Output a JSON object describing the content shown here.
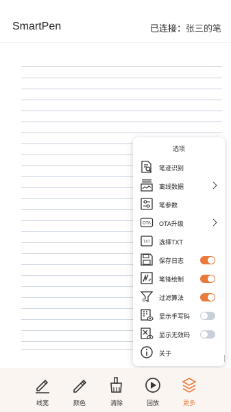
{
  "header": {
    "app_title": "SmartPen",
    "status_prefix": "已连接：",
    "pen_name": "张三的笔"
  },
  "menu": {
    "title": "选项",
    "items": [
      {
        "label": "笔迹识别"
      },
      {
        "label": "离线数据"
      },
      {
        "label": "笔参数"
      },
      {
        "label": "OTA升级"
      },
      {
        "label": "选择TXT"
      },
      {
        "label": "保存日志",
        "toggle": "on"
      },
      {
        "label": "笔锋绘制",
        "toggle": "on"
      },
      {
        "label": "过滤算法",
        "toggle": "on"
      },
      {
        "label": "显示手写码",
        "toggle": "off"
      },
      {
        "label": "显示无效码",
        "toggle": "off"
      },
      {
        "label": "关于"
      }
    ]
  },
  "icons": {
    "ota_text": "OTA",
    "txt_text": "TXT"
  },
  "tabbar": {
    "tabs": [
      {
        "label": "线宽"
      },
      {
        "label": "颜色"
      },
      {
        "label": "清除"
      },
      {
        "label": "回放"
      },
      {
        "label": "更多"
      }
    ],
    "active_color": "#ea7a3c"
  },
  "colors": {
    "accent": "#ea7a3c",
    "toggle_off": "#c8cfd8",
    "ruled_line": "#c6d0de"
  }
}
